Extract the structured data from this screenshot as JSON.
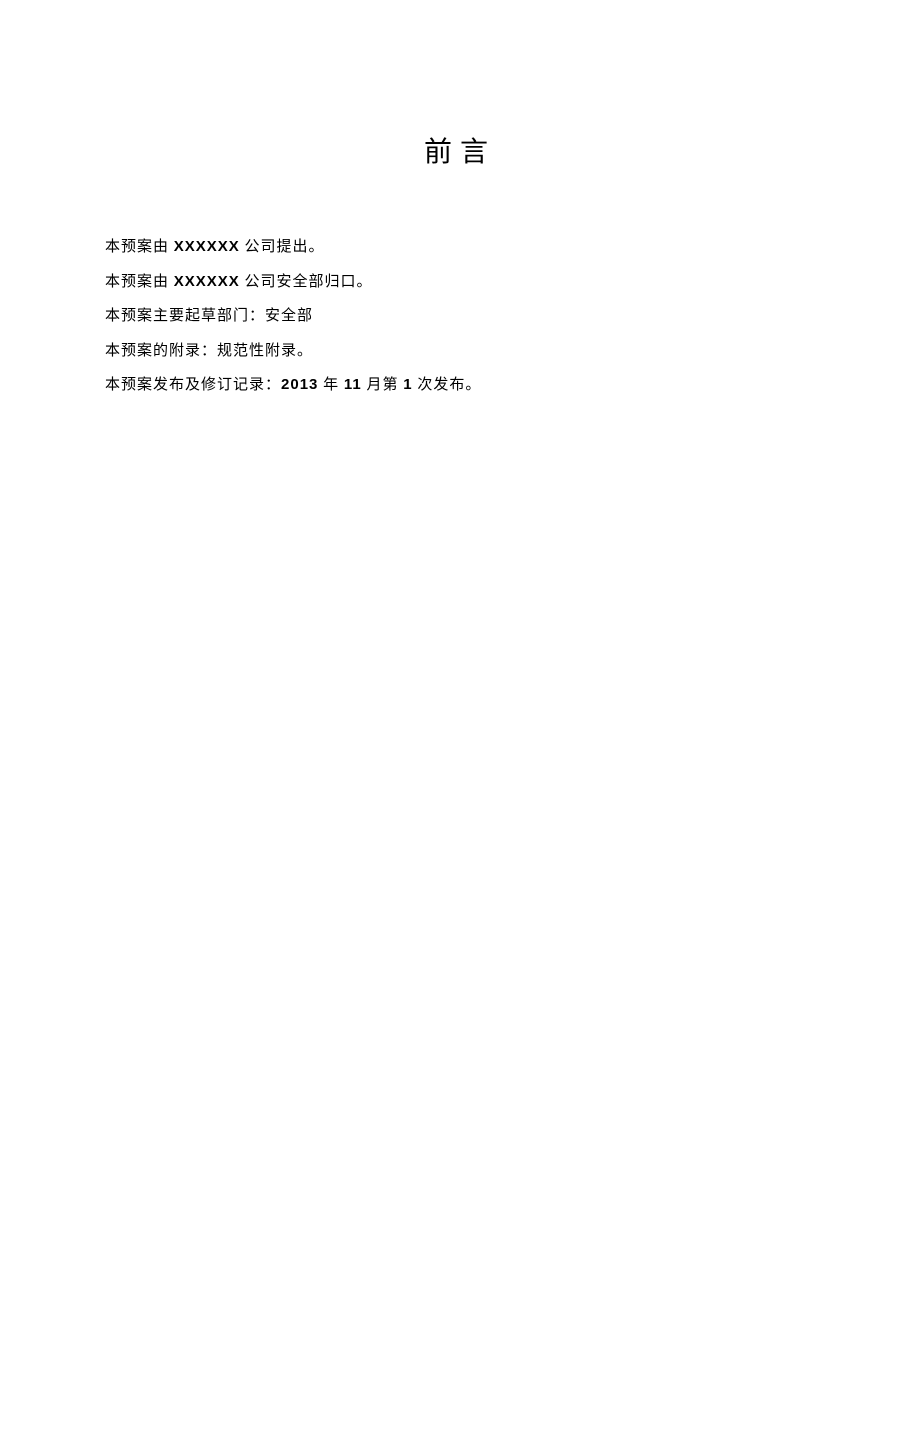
{
  "title": "前言",
  "paragraphs": {
    "p1_prefix": "本预案由 ",
    "p1_bold": "XXXXXX",
    "p1_suffix": " 公司提出。",
    "p2_prefix": "本预案由 ",
    "p2_bold": "XXXXXX",
    "p2_suffix": " 公司安全部归口。",
    "p3": "本预案主要起草部门：安全部",
    "p4": "本预案的附录：规范性附录。",
    "p5_prefix": "本预案发布及修订记录：",
    "p5_bold1": "2013",
    "p5_mid1": " 年 ",
    "p5_bold2": "11",
    "p5_mid2": " 月第 ",
    "p5_bold3": "1",
    "p5_suffix": " 次发布。"
  }
}
